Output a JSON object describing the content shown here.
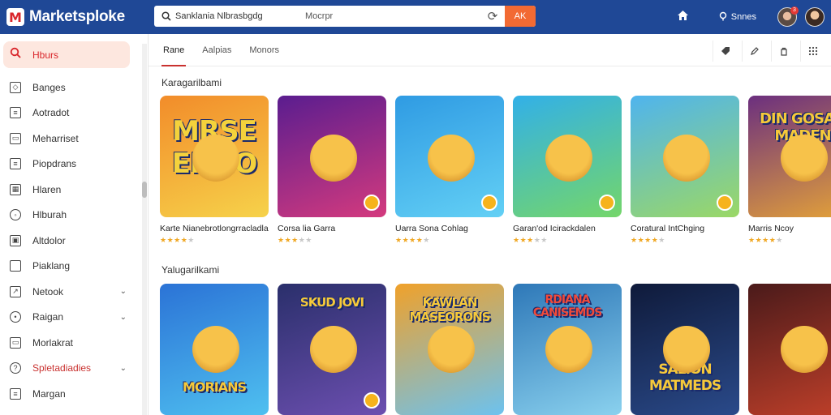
{
  "app": {
    "name": "Marketsploke",
    "logo_letter": "M"
  },
  "search": {
    "value": "Sanklania Nlbrasbgdg",
    "placeholder": "Mocrpr",
    "button_label": "AK"
  },
  "header": {
    "user_label": "Snnes",
    "notification_count": "3"
  },
  "sidebar": {
    "active": {
      "label": "Hburs",
      "icon": "search-icon"
    },
    "items": [
      {
        "label": "Banges",
        "icon": "tag-icon"
      },
      {
        "label": "Aotradot",
        "icon": "list-icon"
      },
      {
        "label": "Meharriset",
        "icon": "document-icon"
      },
      {
        "label": "Piopdrans",
        "icon": "lines-icon"
      },
      {
        "label": "Hlaren",
        "icon": "calendar-icon"
      },
      {
        "label": "Hlburah",
        "icon": "globe-icon"
      },
      {
        "label": "Altdolor",
        "icon": "image-icon"
      },
      {
        "label": "Piaklang",
        "icon": "square-icon"
      },
      {
        "label": "Netook",
        "icon": "chart-icon",
        "expandable": true
      },
      {
        "label": "Raigan",
        "icon": "person-icon",
        "expandable": true
      },
      {
        "label": "Morlakrat",
        "icon": "chat-icon"
      },
      {
        "label": "Spletadiadies",
        "icon": "help-icon",
        "expandable": true,
        "highlight": true
      },
      {
        "label": "Margan",
        "icon": "document-icon"
      }
    ]
  },
  "tabs": [
    "Rane",
    "Aalpias",
    "Monors"
  ],
  "sections": [
    {
      "title": "Karagarilbami",
      "cards": [
        {
          "title": "Karte Nianebrotlongrracladlam",
          "rating": 4,
          "art_text": "MRSE ENGO",
          "colors": [
            "#f28c2a",
            "#f6d24a"
          ]
        },
        {
          "title": "Corsa lia Garra",
          "rating": 3,
          "art_text": "",
          "colors": [
            "#5a1d8f",
            "#d43a7e"
          ]
        },
        {
          "title": "Uarra Sona Cohlag",
          "rating": 4,
          "art_text": "",
          "colors": [
            "#2f9be3",
            "#63d0f5"
          ]
        },
        {
          "title": "Garan'od Icirackdalen",
          "rating": 3,
          "art_text": "",
          "colors": [
            "#32b0e8",
            "#74d66a"
          ]
        },
        {
          "title": "Coratural IntChging",
          "rating": 4,
          "art_text": "",
          "colors": [
            "#4fb4ee",
            "#9bd865"
          ]
        },
        {
          "title": "Marris Ncoy",
          "rating": 4,
          "art_text": "DIN GOSAN MADEN",
          "colors": [
            "#6b2f7f",
            "#e5a338"
          ]
        }
      ]
    },
    {
      "title": "Yalugarilkami",
      "cards": [
        {
          "art_text": "MORIANS",
          "colors": [
            "#2b73d6",
            "#4fc0f0"
          ]
        },
        {
          "art_text": "SKUD JOVI",
          "colors": [
            "#2a2f6b",
            "#6c4fb0"
          ]
        },
        {
          "art_text": "KAWLAN MASEORONS",
          "colors": [
            "#f0a12a",
            "#6cc2ef"
          ]
        },
        {
          "art_text": "RDIANA CANISEMDS",
          "colors": [
            "#2e78b8",
            "#8ad1ee"
          ]
        },
        {
          "art_text": "SALION MATMEDS",
          "colors": [
            "#0f1a3a",
            "#2a4a8a"
          ]
        },
        {
          "art_text": "",
          "colors": [
            "#4a1a1a",
            "#c1402a"
          ]
        }
      ]
    }
  ],
  "colors": {
    "topbar": "#1f4896",
    "accent": "#d9262b",
    "search_button": "#f26a33",
    "star": "#f0a825"
  }
}
